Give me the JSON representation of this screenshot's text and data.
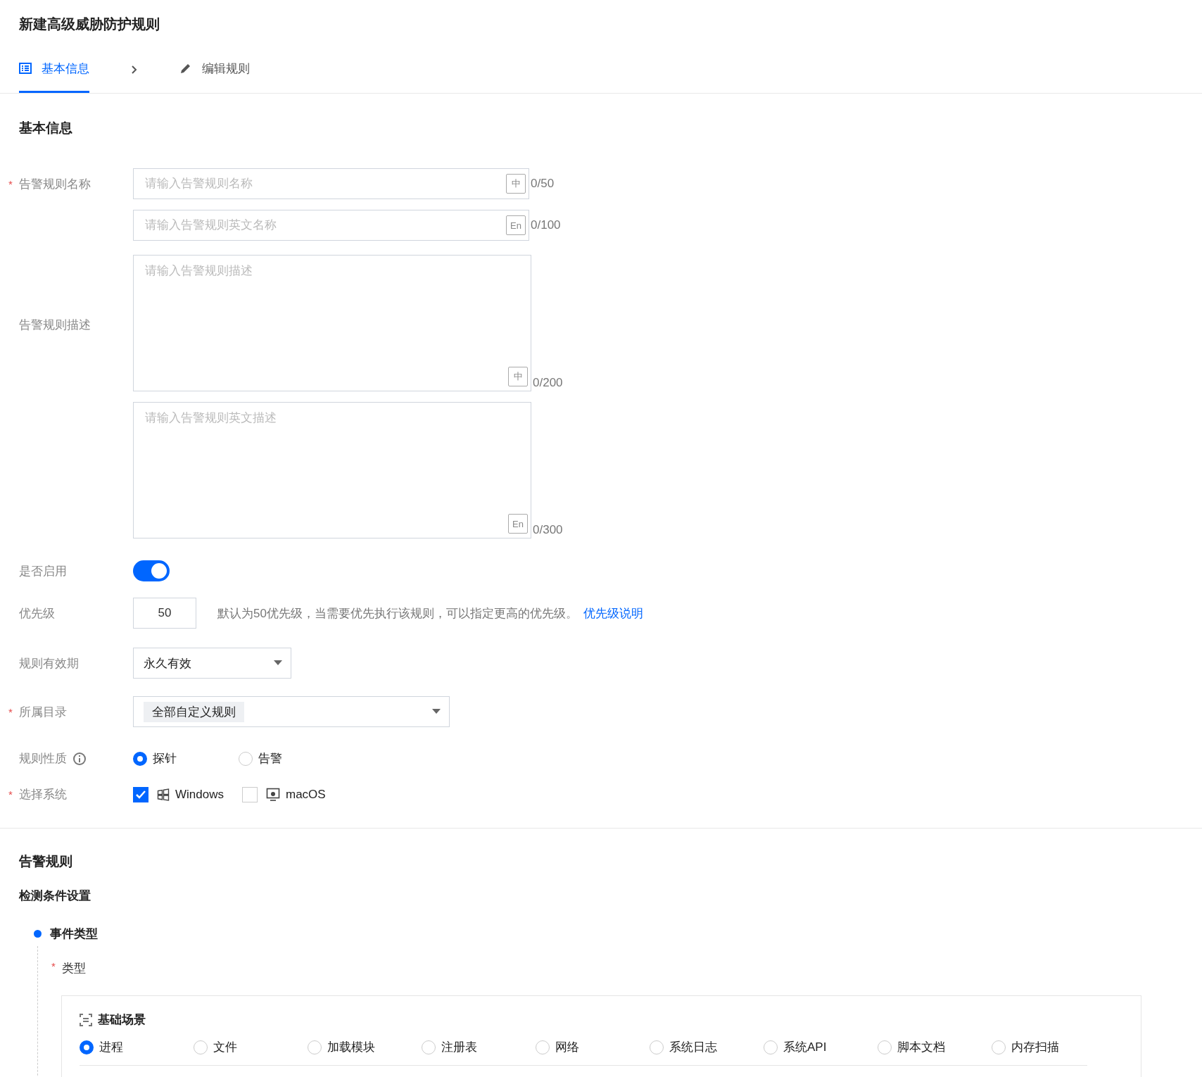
{
  "title": "新建高级威胁防护规则",
  "steps": [
    {
      "label": "基本信息",
      "selected": true
    },
    {
      "label": "编辑规则",
      "selected": false
    }
  ],
  "basic": {
    "heading": "基本信息",
    "name": {
      "label": "告警规则名称",
      "required_mark": "*",
      "inputs": [
        {
          "placeholder": "请输入告警规则名称",
          "lang": "中",
          "counter": "0/50"
        },
        {
          "placeholder": "请输入告警规则英文名称",
          "lang": "En",
          "counter": "0/100"
        }
      ]
    },
    "description": {
      "label": "告警规则描述",
      "inputs": [
        {
          "placeholder": "请输入告警规则描述",
          "lang": "中",
          "counter": "0/200"
        },
        {
          "placeholder": "请输入告警规则英文描述",
          "lang": "En",
          "counter": "0/300"
        }
      ]
    },
    "enabled": {
      "label": "是否启用",
      "on": true
    },
    "priority": {
      "label": "优先级",
      "value": "50",
      "hint": "默认为50优先级，当需要优先执行该规则，可以指定更高的优先级。",
      "link": "优先级说明"
    },
    "validity": {
      "label": "规则有效期",
      "value": "永久有效"
    },
    "directory": {
      "label": "所属目录",
      "required_mark": "*",
      "tag": "全部自定义规则"
    },
    "nature": {
      "label": "规则性质",
      "options": [
        {
          "label": "探针",
          "selected": true
        },
        {
          "label": "告警",
          "selected": false
        }
      ]
    },
    "system": {
      "label": "选择系统",
      "required_mark": "*",
      "options": [
        {
          "label": "Windows",
          "checked": true
        },
        {
          "label": "macOS",
          "checked": false
        }
      ]
    }
  },
  "alert": {
    "heading": "告警规则",
    "subheading": "检测条件设置",
    "step": "事件类型",
    "type_label": "类型",
    "type_mark": "*",
    "scene_title": "基础场景",
    "scenes": [
      {
        "label": "进程",
        "selected": true
      },
      {
        "label": "文件",
        "selected": false
      },
      {
        "label": "加载模块",
        "selected": false
      },
      {
        "label": "注册表",
        "selected": false
      },
      {
        "label": "网络",
        "selected": false
      },
      {
        "label": "系统日志",
        "selected": false
      },
      {
        "label": "系统API",
        "selected": false
      },
      {
        "label": "脚本文档",
        "selected": false
      },
      {
        "label": "内存扫描",
        "selected": false
      }
    ]
  }
}
